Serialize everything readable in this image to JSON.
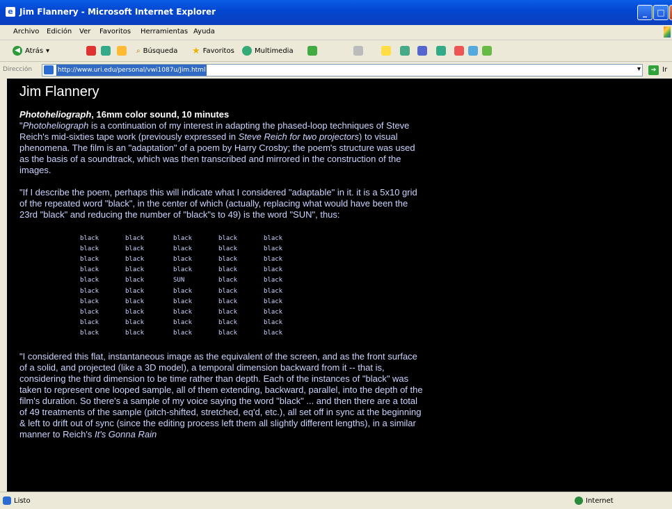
{
  "window": {
    "title": "Jim Flannery - Microsoft Internet Explorer"
  },
  "menu": [
    "Archivo",
    "Edición",
    "Ver",
    "Favoritos",
    "Herramientas",
    "Ayuda"
  ],
  "toolbar": {
    "back_label": "Atrás",
    "search_label": "Búsqueda",
    "favorites_label": "Favoritos",
    "media_label": "Multimedia"
  },
  "address": {
    "label": "Dirección",
    "url": "http://www.uri.edu/personal/vwi1087u/Jim.html",
    "go_label": "Ir"
  },
  "page": {
    "heading": "Jim Flannery",
    "film_title": "Photoheliograph",
    "film_info": ", 16mm color sound, 10 minutes",
    "p1_a": "\"",
    "p1_b": "Photoheliograph",
    "p1_c": " is a continuation of my interest in adapting the phased-loop techniques of Steve Reich's mid-sixties tape work (previously expressed in ",
    "p1_d": "Steve Reich for two projectors",
    "p1_e": ") to visual phenomena. The film is an \"adaptation\" of a poem by Harry Crosby; the poem's structure was used as the basis of a soundtrack, which was then transcribed and mirrored in the construction of the images.",
    "p2": "\"If I describe the poem, perhaps this will indicate what I considered \"adaptable\" in it. it is a 5x10 grid of the repeated word \"black\", in the center of which (actually, replacing what would have been the 23rd \"black\" and reducing the number of \"black\"s to 49) is the word \"SUN\", thus:",
    "poem": [
      [
        "black",
        "black",
        "black",
        "black",
        "black"
      ],
      [
        "black",
        "black",
        "black",
        "black",
        "black"
      ],
      [
        "black",
        "black",
        "black",
        "black",
        "black"
      ],
      [
        "black",
        "black",
        "black",
        "black",
        "black"
      ],
      [
        "black",
        "black",
        "SUN",
        "black",
        "black"
      ],
      [
        "black",
        "black",
        "black",
        "black",
        "black"
      ],
      [
        "black",
        "black",
        "black",
        "black",
        "black"
      ],
      [
        "black",
        "black",
        "black",
        "black",
        "black"
      ],
      [
        "black",
        "black",
        "black",
        "black",
        "black"
      ],
      [
        "black",
        "black",
        "black",
        "black",
        "black"
      ]
    ],
    "p3_a": "\"I considered this flat, instantaneous image as the equivalent of the screen, and as the front surface of a solid, and projected (like a 3D model), a temporal dimension backward from it -- that is, considering the third dimension to be time rather than depth. Each of the instances of \"black\" was taken to represent one looped sample, all of them extending, backward, parallel, into the depth of the film's duration. So there's a sample of my voice saying the word \"black\" ... and then there are a total of 49 treatments of the sample (pitch-shifted, stretched, eq'd, etc.), all set off in sync at the beginning & left to drift out of sync (since the editing process left them all slightly different lengths), in a similar manner to Reich's ",
    "p3_b": "It's Gonna Rain"
  },
  "status": {
    "left": "Listo",
    "zone": "Internet"
  }
}
